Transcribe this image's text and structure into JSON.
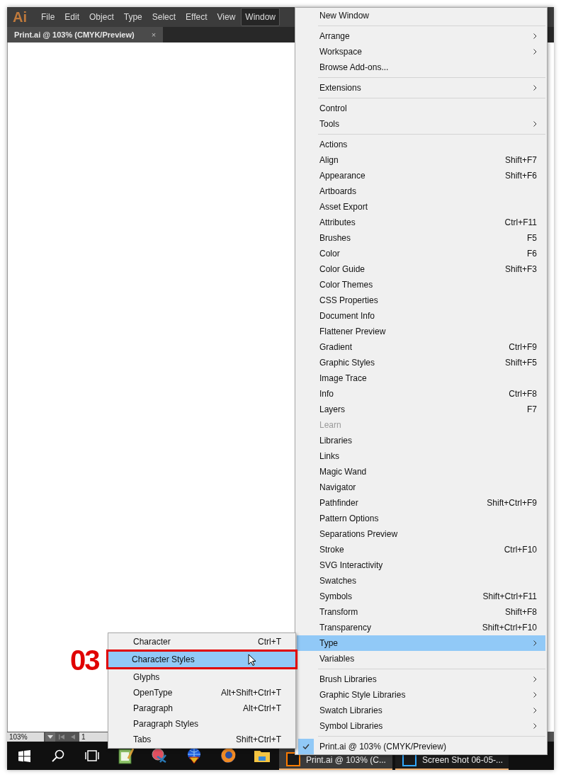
{
  "app": {
    "logo": "Ai",
    "menu_bar": [
      {
        "label": "File",
        "selected": false
      },
      {
        "label": "Edit",
        "selected": false
      },
      {
        "label": "Object",
        "selected": false
      },
      {
        "label": "Type",
        "selected": false
      },
      {
        "label": "Select",
        "selected": false
      },
      {
        "label": "Effect",
        "selected": false
      },
      {
        "label": "View",
        "selected": false
      },
      {
        "label": "Window",
        "selected": true
      }
    ]
  },
  "document_tab": {
    "title": "Print.ai @ 103% (CMYK/Preview)",
    "close": "×"
  },
  "status_bar": {
    "zoom": "103%",
    "page": "1"
  },
  "taskbar": {
    "tasks": [
      {
        "kind": "illustrator",
        "label": "Print.ai @ 103% (C..."
      },
      {
        "kind": "photoshop",
        "label": "Screen Shot 06-05-..."
      }
    ]
  },
  "window_menu": {
    "sections": [
      [
        {
          "label": "New Window",
          "submenu": false,
          "selected": false,
          "disabled": false
        }
      ],
      [
        {
          "label": "Arrange",
          "submenu": true,
          "selected": false,
          "disabled": false
        },
        {
          "label": "Workspace",
          "submenu": true,
          "selected": false,
          "disabled": false
        },
        {
          "label": "Browse Add-ons...",
          "submenu": false,
          "selected": false,
          "disabled": false
        }
      ],
      [
        {
          "label": "Extensions",
          "submenu": true,
          "selected": false,
          "disabled": false
        }
      ],
      [
        {
          "label": "Control",
          "submenu": false,
          "selected": false,
          "disabled": false
        },
        {
          "label": "Tools",
          "submenu": true,
          "selected": false,
          "disabled": false
        }
      ],
      [
        {
          "label": "Actions",
          "submenu": false,
          "selected": false,
          "disabled": false
        },
        {
          "label": "Align",
          "shortcut": "Shift+F7",
          "submenu": false,
          "selected": false,
          "disabled": false
        },
        {
          "label": "Appearance",
          "shortcut": "Shift+F6",
          "submenu": false,
          "selected": false,
          "disabled": false
        },
        {
          "label": "Artboards",
          "submenu": false,
          "selected": false,
          "disabled": false
        },
        {
          "label": "Asset Export",
          "submenu": false,
          "selected": false,
          "disabled": false
        },
        {
          "label": "Attributes",
          "shortcut": "Ctrl+F11",
          "submenu": false,
          "selected": false,
          "disabled": false
        },
        {
          "label": "Brushes",
          "shortcut": "F5",
          "submenu": false,
          "selected": false,
          "disabled": false
        },
        {
          "label": "Color",
          "shortcut": "F6",
          "submenu": false,
          "selected": false,
          "disabled": false
        },
        {
          "label": "Color Guide",
          "shortcut": "Shift+F3",
          "submenu": false,
          "selected": false,
          "disabled": false
        },
        {
          "label": "Color Themes",
          "submenu": false,
          "selected": false,
          "disabled": false
        },
        {
          "label": "CSS Properties",
          "submenu": false,
          "selected": false,
          "disabled": false
        },
        {
          "label": "Document Info",
          "submenu": false,
          "selected": false,
          "disabled": false
        },
        {
          "label": "Flattener Preview",
          "submenu": false,
          "selected": false,
          "disabled": false
        },
        {
          "label": "Gradient",
          "shortcut": "Ctrl+F9",
          "submenu": false,
          "selected": false,
          "disabled": false
        },
        {
          "label": "Graphic Styles",
          "shortcut": "Shift+F5",
          "submenu": false,
          "selected": false,
          "disabled": false
        },
        {
          "label": "Image Trace",
          "submenu": false,
          "selected": false,
          "disabled": false
        },
        {
          "label": "Info",
          "shortcut": "Ctrl+F8",
          "submenu": false,
          "selected": false,
          "disabled": false
        },
        {
          "label": "Layers",
          "shortcut": "F7",
          "submenu": false,
          "selected": false,
          "disabled": false
        },
        {
          "label": "Learn",
          "submenu": false,
          "selected": false,
          "disabled": true
        },
        {
          "label": "Libraries",
          "submenu": false,
          "selected": false,
          "disabled": false
        },
        {
          "label": "Links",
          "submenu": false,
          "selected": false,
          "disabled": false
        },
        {
          "label": "Magic Wand",
          "submenu": false,
          "selected": false,
          "disabled": false
        },
        {
          "label": "Navigator",
          "submenu": false,
          "selected": false,
          "disabled": false
        },
        {
          "label": "Pathfinder",
          "shortcut": "Shift+Ctrl+F9",
          "submenu": false,
          "selected": false,
          "disabled": false
        },
        {
          "label": "Pattern Options",
          "submenu": false,
          "selected": false,
          "disabled": false
        },
        {
          "label": "Separations Preview",
          "submenu": false,
          "selected": false,
          "disabled": false
        },
        {
          "label": "Stroke",
          "shortcut": "Ctrl+F10",
          "submenu": false,
          "selected": false,
          "disabled": false
        },
        {
          "label": "SVG Interactivity",
          "submenu": false,
          "selected": false,
          "disabled": false
        },
        {
          "label": "Swatches",
          "submenu": false,
          "selected": false,
          "disabled": false
        },
        {
          "label": "Symbols",
          "shortcut": "Shift+Ctrl+F11",
          "submenu": false,
          "selected": false,
          "disabled": false
        },
        {
          "label": "Transform",
          "shortcut": "Shift+F8",
          "submenu": false,
          "selected": false,
          "disabled": false
        },
        {
          "label": "Transparency",
          "shortcut": "Shift+Ctrl+F10",
          "submenu": false,
          "selected": false,
          "disabled": false
        },
        {
          "label": "Type",
          "submenu": true,
          "selected": true,
          "disabled": false
        },
        {
          "label": "Variables",
          "submenu": false,
          "selected": false,
          "disabled": false
        }
      ],
      [
        {
          "label": "Brush Libraries",
          "submenu": true,
          "selected": false,
          "disabled": false
        },
        {
          "label": "Graphic Style Libraries",
          "submenu": true,
          "selected": false,
          "disabled": false
        },
        {
          "label": "Swatch Libraries",
          "submenu": true,
          "selected": false,
          "disabled": false
        },
        {
          "label": "Symbol Libraries",
          "submenu": true,
          "selected": false,
          "disabled": false
        }
      ]
    ],
    "open_documents": [
      {
        "label": "Print.ai @ 103% (CMYK/Preview)",
        "checked": true
      }
    ]
  },
  "type_submenu": {
    "items": [
      {
        "label": "Character",
        "shortcut": "Ctrl+T",
        "selected": false
      },
      {
        "label": "Character Styles",
        "selected": true
      },
      {
        "label": "Glyphs",
        "selected": false
      },
      {
        "label": "OpenType",
        "shortcut": "Alt+Shift+Ctrl+T",
        "selected": false
      },
      {
        "label": "Paragraph",
        "shortcut": "Alt+Ctrl+T",
        "selected": false
      },
      {
        "label": "Paragraph Styles",
        "selected": false
      },
      {
        "label": "Tabs",
        "shortcut": "Shift+Ctrl+T",
        "selected": false
      }
    ]
  },
  "annotation": {
    "label": "03"
  }
}
